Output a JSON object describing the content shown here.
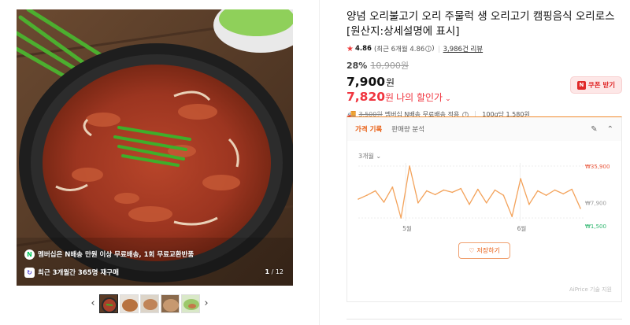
{
  "gallery": {
    "overlay_shipping": "멤버십은 N배송 만원 이상 무료배송, 1회 무료교환반품",
    "overlay_repurchase": "최근 3개월간 365명 재구매",
    "counter_current": "1",
    "counter_total": "/ 12",
    "prev_icon": "chevron-left-icon",
    "next_icon": "chevron-right-icon",
    "thumbnail_count": 5
  },
  "product": {
    "title": "양념 오리불고기 오리 주물럭 생 오리고기 캠핑음식 오리로스 [원산지:상세설명에 표시]",
    "rating": "4.86",
    "recent_rating": "(최근 6개월 4.86",
    "recent_rating_close": ")",
    "review_count": "3,986건 리뷰",
    "discount_rate": "28%",
    "original_price": "10,900원",
    "price": "7,900",
    "price_unit": "원",
    "my_price": "7,820",
    "my_price_unit": "원",
    "my_price_label": "나의 할인가",
    "coupon_label": "쿠폰 받기",
    "shipping_original": "3,500원",
    "shipping_text": "멤버십 N배송 무료배송 적용",
    "unit_price": "100g당 1,580원"
  },
  "price_history": {
    "tab_active": "가격 기록",
    "tab_other": "판매량 분석",
    "period": "3개월",
    "save_label": "저장하기",
    "credit": "AiPrice 기술 지원",
    "colors": {
      "line": "#f3a25a",
      "max": "#e8553a",
      "min": "#2ab56b"
    }
  },
  "chart_data": {
    "type": "line",
    "title": "",
    "xlabel": "",
    "ylabel": "",
    "x_tick_labels": [
      "5월",
      "6월"
    ],
    "y_markers": [
      {
        "label": "₩35,900",
        "value": 35900,
        "kind": "max"
      },
      {
        "label": "₩7,900",
        "value": 7900,
        "kind": "current"
      },
      {
        "label": "₩1,500",
        "value": 1500,
        "kind": "min"
      }
    ],
    "ylim": [
      1500,
      35900
    ],
    "series": [
      {
        "values": [
          14000,
          16500,
          19500,
          12000,
          22000,
          1500,
          35900,
          11500,
          19500,
          17000,
          20000,
          18500,
          21000,
          10500,
          20500,
          11500,
          20000,
          16500,
          2500,
          27500,
          10500,
          19500,
          16500,
          20000,
          17500,
          20500,
          7900
        ]
      }
    ]
  }
}
